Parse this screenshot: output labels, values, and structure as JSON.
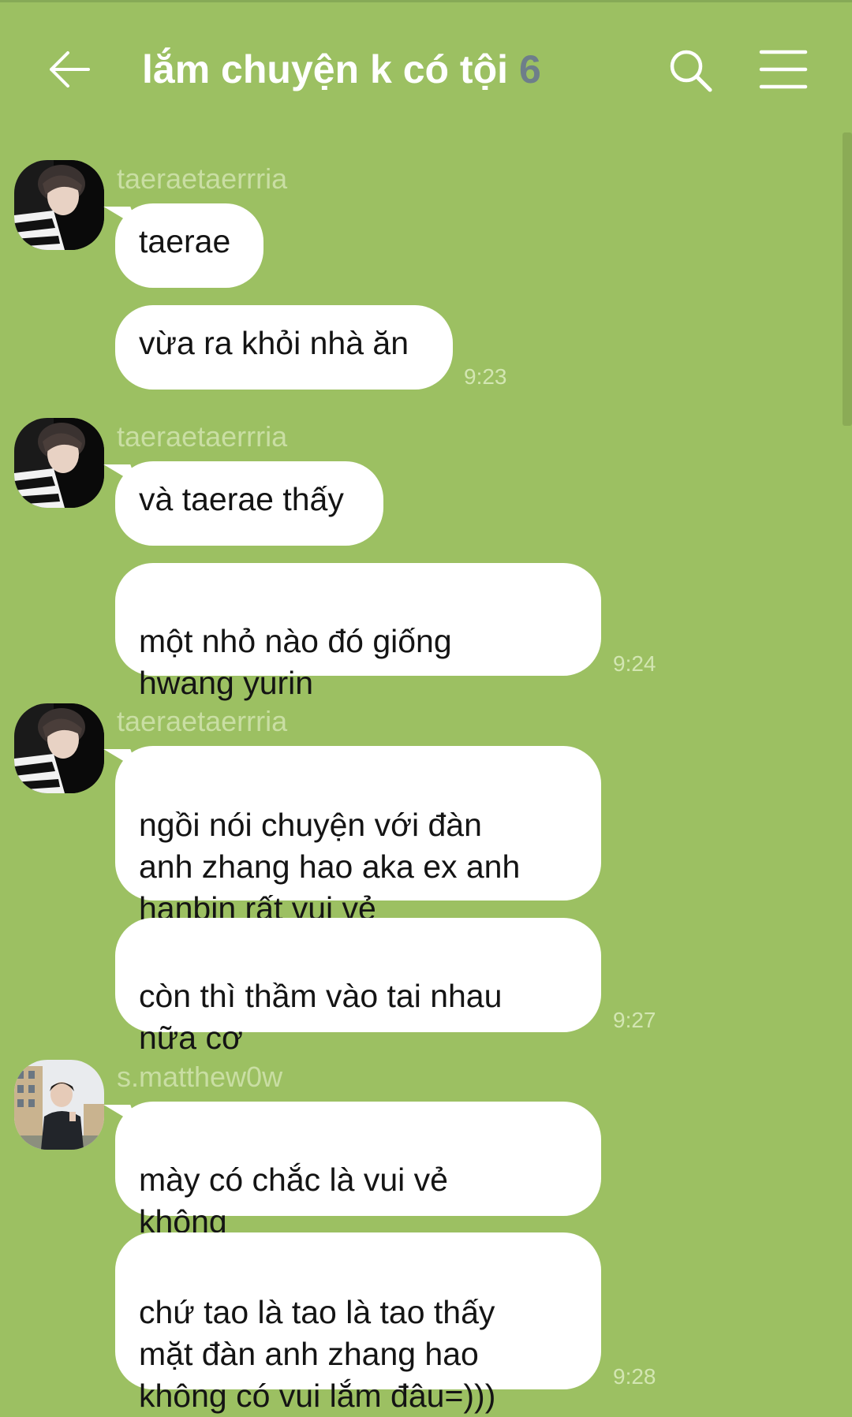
{
  "header": {
    "title": "lắm chuyện k có tội",
    "member_count": "6"
  },
  "colors": {
    "background": "#9cc062",
    "bubble": "#ffffff",
    "sender_name": "#c9dea3",
    "timestamp": "#d3e6b2",
    "count": "#6e7e8a"
  },
  "groups": [
    {
      "sender": "taeraetaerrria",
      "avatar": "avatar-taeraetaerrria",
      "messages": [
        {
          "text": "taerae",
          "time": ""
        },
        {
          "text": "vừa ra khỏi nhà ăn",
          "time": "9:23"
        }
      ]
    },
    {
      "sender": "taeraetaerrria",
      "avatar": "avatar-taeraetaerrria",
      "messages": [
        {
          "text": "và taerae thấy",
          "time": ""
        },
        {
          "text": "một nhỏ nào đó giống\nhwang yurin",
          "time": "9:24"
        }
      ]
    },
    {
      "sender": "taeraetaerrria",
      "avatar": "avatar-taeraetaerrria",
      "messages": [
        {
          "text": "ngồi nói chuyện với đàn\nanh zhang hao aka ex anh\nhanbin rất vui vẻ",
          "time": ""
        },
        {
          "text": "còn thì thầm vào tai nhau\nnữa cơ",
          "time": "9:27"
        }
      ]
    },
    {
      "sender": "s.matthew0w",
      "avatar": "avatar-s-matthew0w",
      "messages": [
        {
          "text": "mày có chắc là vui vẻ\nkhông",
          "time": ""
        },
        {
          "text": "chứ tao là tao là tao thấy\nmặt đàn anh zhang hao\nkhông có vui lắm đâu=)))",
          "time": "9:28"
        }
      ]
    }
  ]
}
